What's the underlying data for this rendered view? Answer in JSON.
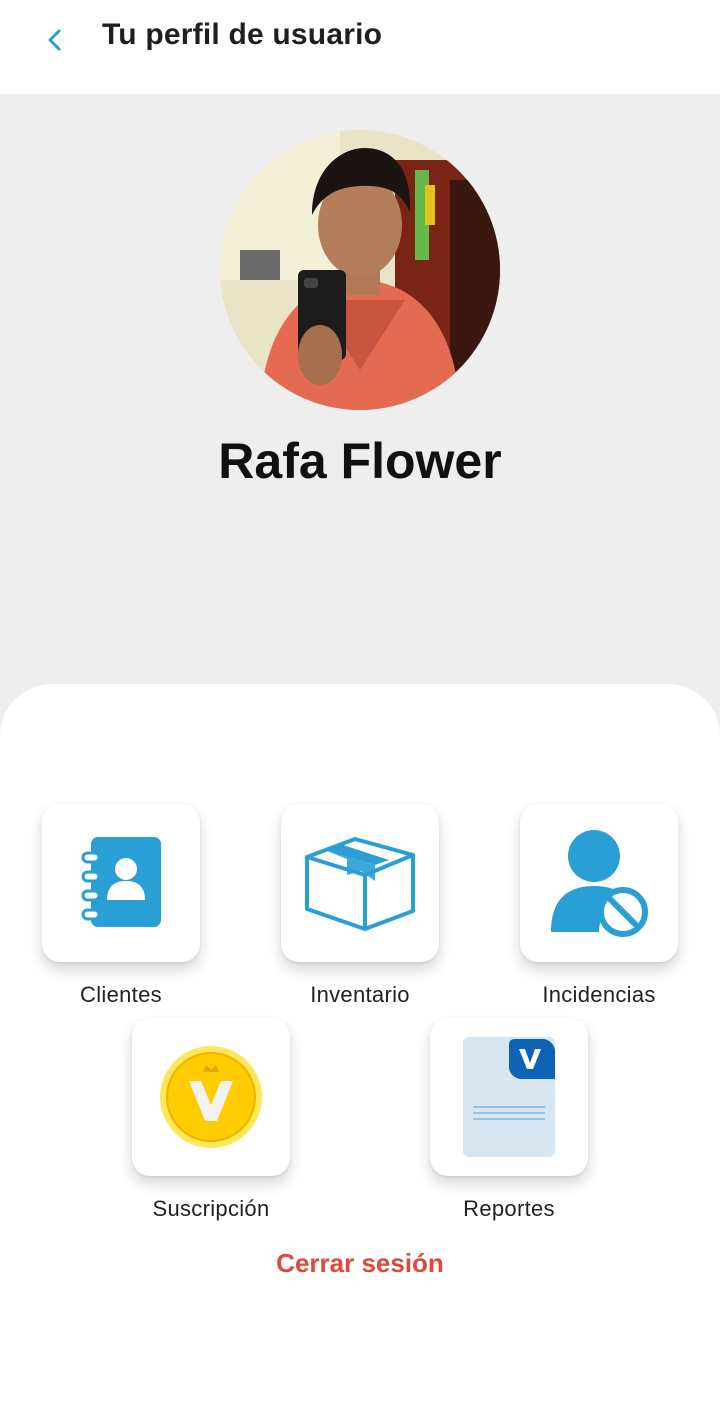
{
  "header": {
    "title": "Tu perfil de usuario",
    "back_icon": "chevron-left-icon"
  },
  "profile": {
    "name": "Rafa Flower",
    "avatar": "profile-photo"
  },
  "menu": [
    {
      "label": "Clientes",
      "icon": "contacts-book-icon"
    },
    {
      "label": "Inventario",
      "icon": "box-icon"
    },
    {
      "label": "Incidencias",
      "icon": "user-blocked-icon"
    },
    {
      "label": "Suscripción",
      "icon": "gold-coin-icon"
    },
    {
      "label": "Reportes",
      "icon": "document-report-icon"
    }
  ],
  "logout_label": "Cerrar sesión",
  "colors": {
    "accent": "#2a9fd6",
    "logout": "#e0483a",
    "hero_background": "#eeeeee",
    "coin": "#ffcc00"
  }
}
